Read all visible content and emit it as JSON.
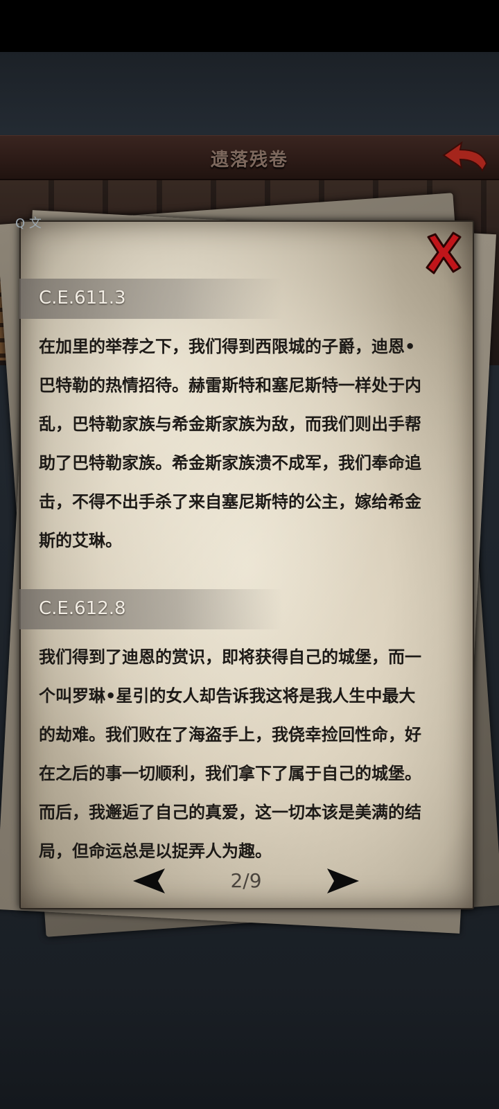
{
  "header": {
    "title": "遗落残卷"
  },
  "background": {
    "search_stub": "Q 文"
  },
  "entries": [
    {
      "date": "C.E.611.3",
      "lines": [
        "在加里的举荐之下，我们得到西限城的子爵，迪恩•",
        "巴特勒的热情招待。赫雷斯特和塞尼斯特一样处于内",
        "乱，巴特勒家族与希金斯家族为敌，而我们则出手帮",
        "助了巴特勒家族。希金斯家族溃不成军，我们奉命追",
        "击，不得不出手杀了来自塞尼斯特的公主，嫁给希金",
        "斯的艾琳。"
      ]
    },
    {
      "date": "C.E.612.8",
      "lines": [
        "我们得到了迪恩的赏识，即将获得自己的城堡，而一",
        "个叫罗琳•星引的女人却告诉我这将是我人生中最大",
        "的劫难。我们败在了海盗手上，我侥幸捡回性命，好",
        "在之后的事一切顺利，我们拿下了属于自己的城堡。",
        "而后，我邂逅了自己的真爱，这一切本该是美满的结",
        "局，但命运总是以捉弄人为趣。"
      ]
    }
  ],
  "pager": {
    "page_label": "2/9"
  },
  "icons": {
    "back": "back-arrow-icon",
    "close": "close-x-icon",
    "prev": "prev-triangle-icon",
    "next": "next-triangle-icon"
  },
  "colors": {
    "close_red": "#c0151a",
    "back_red": "#a5251c",
    "paper": "#d8cfbc",
    "text": "#1d1a17"
  }
}
